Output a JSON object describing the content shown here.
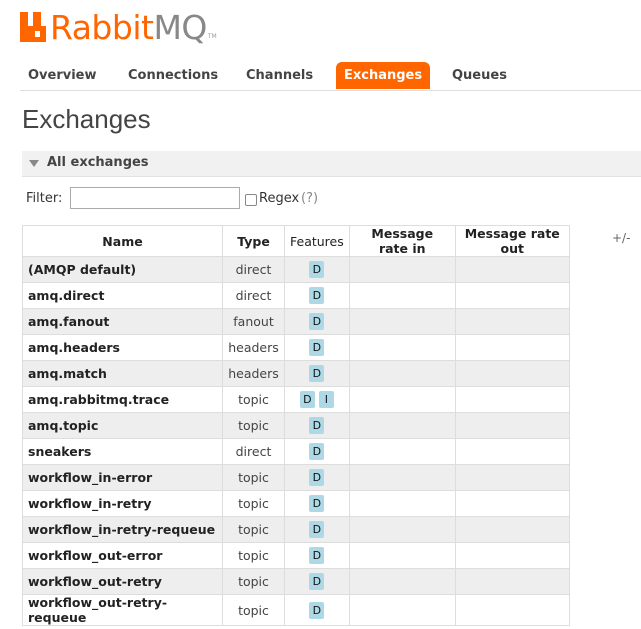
{
  "app": {
    "logo_part1": "Rabbit",
    "logo_part2": "MQ",
    "trademark": "TM"
  },
  "tabs": [
    {
      "label": "Overview",
      "active": false
    },
    {
      "label": "Connections",
      "active": false
    },
    {
      "label": "Channels",
      "active": false
    },
    {
      "label": "Exchanges",
      "active": true
    },
    {
      "label": "Queues",
      "active": false
    }
  ],
  "page_title": "Exchanges",
  "section_title": "All exchanges",
  "filter": {
    "label": "Filter:",
    "value": "",
    "regex_label": "Regex",
    "regex_help": "(?)",
    "regex_checked": false
  },
  "table": {
    "headers": [
      "Name",
      "Type",
      "Features",
      "Message rate in",
      "Message rate out"
    ],
    "column_toggle": "+/-",
    "rows": [
      {
        "name": "(AMQP default)",
        "type": "direct",
        "features": [
          "D"
        ],
        "rate_in": "",
        "rate_out": ""
      },
      {
        "name": "amq.direct",
        "type": "direct",
        "features": [
          "D"
        ],
        "rate_in": "",
        "rate_out": ""
      },
      {
        "name": "amq.fanout",
        "type": "fanout",
        "features": [
          "D"
        ],
        "rate_in": "",
        "rate_out": ""
      },
      {
        "name": "amq.headers",
        "type": "headers",
        "features": [
          "D"
        ],
        "rate_in": "",
        "rate_out": ""
      },
      {
        "name": "amq.match",
        "type": "headers",
        "features": [
          "D"
        ],
        "rate_in": "",
        "rate_out": ""
      },
      {
        "name": "amq.rabbitmq.trace",
        "type": "topic",
        "features": [
          "D",
          "I"
        ],
        "rate_in": "",
        "rate_out": ""
      },
      {
        "name": "amq.topic",
        "type": "topic",
        "features": [
          "D"
        ],
        "rate_in": "",
        "rate_out": ""
      },
      {
        "name": "sneakers",
        "type": "direct",
        "features": [
          "D"
        ],
        "rate_in": "",
        "rate_out": ""
      },
      {
        "name": "workflow_in-error",
        "type": "topic",
        "features": [
          "D"
        ],
        "rate_in": "",
        "rate_out": ""
      },
      {
        "name": "workflow_in-retry",
        "type": "topic",
        "features": [
          "D"
        ],
        "rate_in": "",
        "rate_out": ""
      },
      {
        "name": "workflow_in-retry-requeue",
        "type": "topic",
        "features": [
          "D"
        ],
        "rate_in": "",
        "rate_out": ""
      },
      {
        "name": "workflow_out-error",
        "type": "topic",
        "features": [
          "D"
        ],
        "rate_in": "",
        "rate_out": ""
      },
      {
        "name": "workflow_out-retry",
        "type": "topic",
        "features": [
          "D"
        ],
        "rate_in": "",
        "rate_out": ""
      },
      {
        "name": "workflow_out-retry-requeue",
        "type": "topic",
        "features": [
          "D"
        ],
        "rate_in": "",
        "rate_out": ""
      }
    ]
  },
  "colors": {
    "brand": "#ff6600",
    "badge": "#add8e6",
    "row_alt": "#eeeeee"
  }
}
